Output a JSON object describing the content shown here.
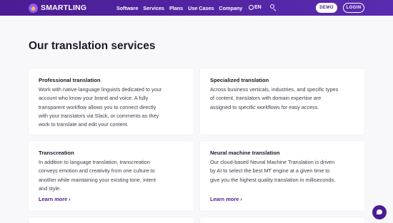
{
  "brand": {
    "name": "SMARTLING"
  },
  "nav": {
    "links": [
      "Software",
      "Services",
      "Plans",
      "Use Cases",
      "Company"
    ],
    "lang": "EN",
    "demo": "DEMO",
    "login": "LOGIN"
  },
  "page": {
    "title": "Our translation services"
  },
  "cards": [
    {
      "title": "Professional translation",
      "lines": [
        "Work with native-language linguists dedicated to your",
        "account who know your brand and voice. A fully",
        "transparent workflow allows you to connect directly",
        "with your translators via Slack, or comments as they",
        "work to translate and edit your content."
      ]
    },
    {
      "title": "Specialized translation",
      "lines": [
        "Across business verticals, industries, and specific types",
        "of content, translators with domain expertise are",
        "assigned to specific workflows for easy access."
      ]
    },
    {
      "title": "Transcreation",
      "lines": [
        "In addition to language translation, transcreation",
        "conveys emotion and creativity from one culture to",
        "another while maintaining your existing tone, intent",
        "and style."
      ],
      "link": "Learn more ›"
    },
    {
      "title": "Neural machine translation",
      "lines": [
        "Our cloud-based Neural Machine Translation is driven",
        "by AI to select the best MT engine at a given time to",
        "give you the highest quality translation in milliseconds."
      ],
      "link": "Learn more ›"
    }
  ],
  "colors": {
    "brand": "#4b1c93",
    "background": "#f8f8fb",
    "card": "#ffffff"
  }
}
